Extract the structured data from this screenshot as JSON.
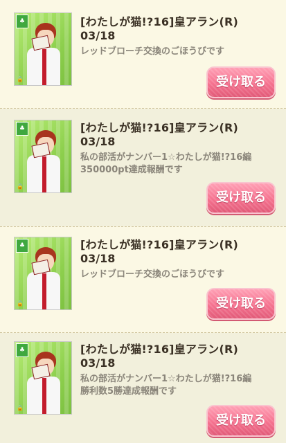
{
  "rewards": [
    {
      "title": "[わたしが猫!?16]皇アラン(R)",
      "date": "03/18",
      "desc_line1": "レッドブローチ交換のごほうびです",
      "desc_line2": "",
      "button_label": "受け取る"
    },
    {
      "title": "[わたしが猫!?16]皇アラン(R)",
      "date": "03/18",
      "desc_line1": "私の部活がナンバー1☆わたしが猫!?16編",
      "desc_line2": "350000pt達成報酬です",
      "button_label": "受け取る"
    },
    {
      "title": "[わたしが猫!?16]皇アラン(R)",
      "date": "03/18",
      "desc_line1": "レッドブローチ交換のごほうびです",
      "desc_line2": "",
      "button_label": "受け取る"
    },
    {
      "title": "[わたしが猫!?16]皇アラン(R)",
      "date": "03/18",
      "desc_line1": "私の部活がナンバー1☆わたしが猫!?16編",
      "desc_line2": "勝利数5勝達成報酬です",
      "button_label": "受け取る"
    }
  ],
  "colors": {
    "background": "#fbf8e4",
    "alt_background": "#f2f0dc",
    "button": "#f5728f",
    "card_bg": "#9cdc5c"
  },
  "icons": {
    "card_badge": "clover-badge-icon",
    "card_lock": "lock-icon"
  }
}
